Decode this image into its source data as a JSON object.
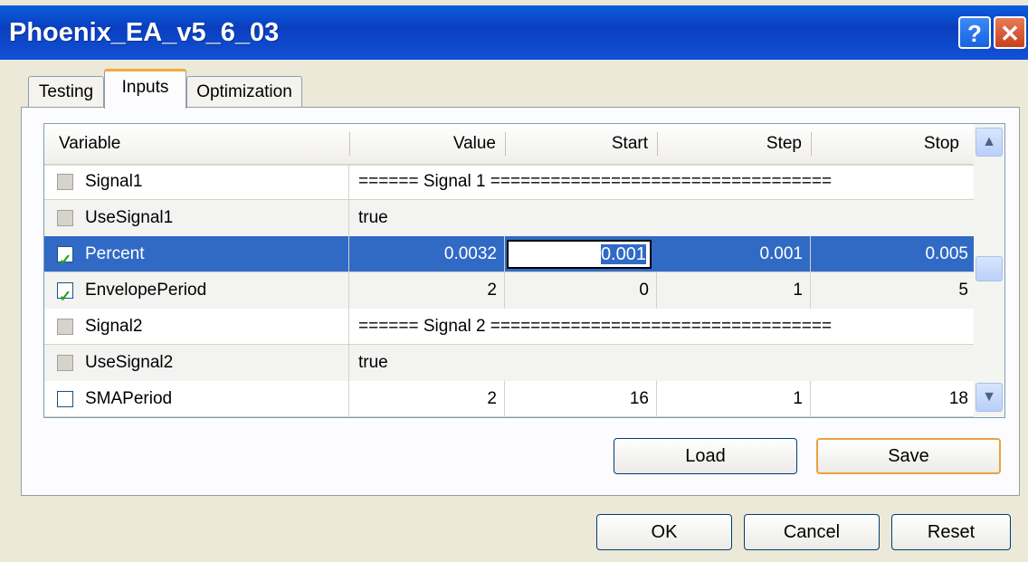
{
  "window": {
    "title": "Phoenix_EA_v5_6_03",
    "help_label": "?",
    "close_label": "✕"
  },
  "tabs": [
    {
      "label": "Testing"
    },
    {
      "label": "Inputs"
    },
    {
      "label": "Optimization"
    }
  ],
  "columns": {
    "variable": "Variable",
    "value": "Value",
    "start": "Start",
    "step": "Step",
    "stop": "Stop"
  },
  "rows": [
    {
      "name": "Signal1",
      "checked": false,
      "disabled": true,
      "text": "====== Signal 1 =================================="
    },
    {
      "name": "UseSignal1",
      "checked": false,
      "disabled": true,
      "text": "true"
    },
    {
      "name": "Percent",
      "checked": true,
      "selected": true,
      "value": "0.0032",
      "start": "0.001",
      "step": "0.001",
      "stop": "0.005"
    },
    {
      "name": "EnvelopePeriod",
      "checked": true,
      "value": "2",
      "start": "0",
      "step": "1",
      "stop": "5"
    },
    {
      "name": "Signal2",
      "checked": false,
      "disabled": true,
      "text": "====== Signal 2 =================================="
    },
    {
      "name": "UseSignal2",
      "checked": false,
      "disabled": true,
      "text": "true"
    },
    {
      "name": "SMAPeriod",
      "checked": false,
      "value": "2",
      "start": "16",
      "step": "1",
      "stop": "18"
    }
  ],
  "scrollbar": {
    "up_icon": "▲",
    "down_icon": "▼"
  },
  "buttons": {
    "load": "Load",
    "save": "Save",
    "ok": "OK",
    "cancel": "Cancel",
    "reset": "Reset"
  }
}
